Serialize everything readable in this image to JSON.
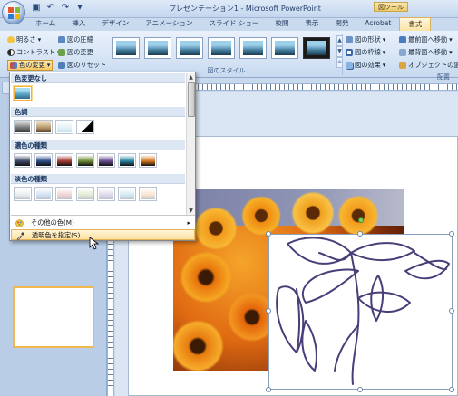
{
  "window": {
    "title": "プレゼンテーション1 - Microsoft PowerPoint",
    "context_tool_label": "図ツール"
  },
  "quick_access": [
    "save-icon",
    "undo-icon",
    "redo-icon",
    "customize-icon"
  ],
  "tabs": [
    {
      "label": "ホーム",
      "active": false
    },
    {
      "label": "挿入",
      "active": false
    },
    {
      "label": "デザイン",
      "active": false
    },
    {
      "label": "アニメーション",
      "active": false
    },
    {
      "label": "スライド ショー",
      "active": false
    },
    {
      "label": "校閲",
      "active": false
    },
    {
      "label": "表示",
      "active": false
    },
    {
      "label": "開発",
      "active": false
    },
    {
      "label": "Acrobat",
      "active": false
    },
    {
      "label": "書式",
      "active": true
    }
  ],
  "ribbon": {
    "adjust": {
      "brightness": "明るさ",
      "contrast": "コントラスト",
      "recolor": "色の変更",
      "compress": "図の圧縮",
      "change_picture": "図の変更",
      "reset": "図のリセット"
    },
    "picture_styles": {
      "group_label": "図のスタイル",
      "shape": "図の形状",
      "border": "図の枠線",
      "effects": "図の効果"
    },
    "arrange": {
      "group_label": "配置",
      "bring_front": "最前面へ移動",
      "send_back": "最背面へ移動",
      "selection_pane": "オブジェクトの選択"
    }
  },
  "recolor_menu": {
    "sections": {
      "no_recolor": "色変更なし",
      "color_modes": "色調",
      "dark_variations": "濃色の種類",
      "light_variations": "淡色の種類"
    },
    "items": {
      "more_variations": "その他の色(M)",
      "set_transparent": "透明色を指定(S)"
    },
    "dark_colors": [
      "#3b4a66",
      "#2d4f86",
      "#a63a37",
      "#6f8e35",
      "#6a4d94",
      "#2a86a1",
      "#d9761f"
    ],
    "light_colors": [
      "#e9ecef",
      "#d2e0f1",
      "#f1d2d1",
      "#e2ebd0",
      "#dfd7ea",
      "#d2e9f0",
      "#fbe3cc"
    ]
  }
}
